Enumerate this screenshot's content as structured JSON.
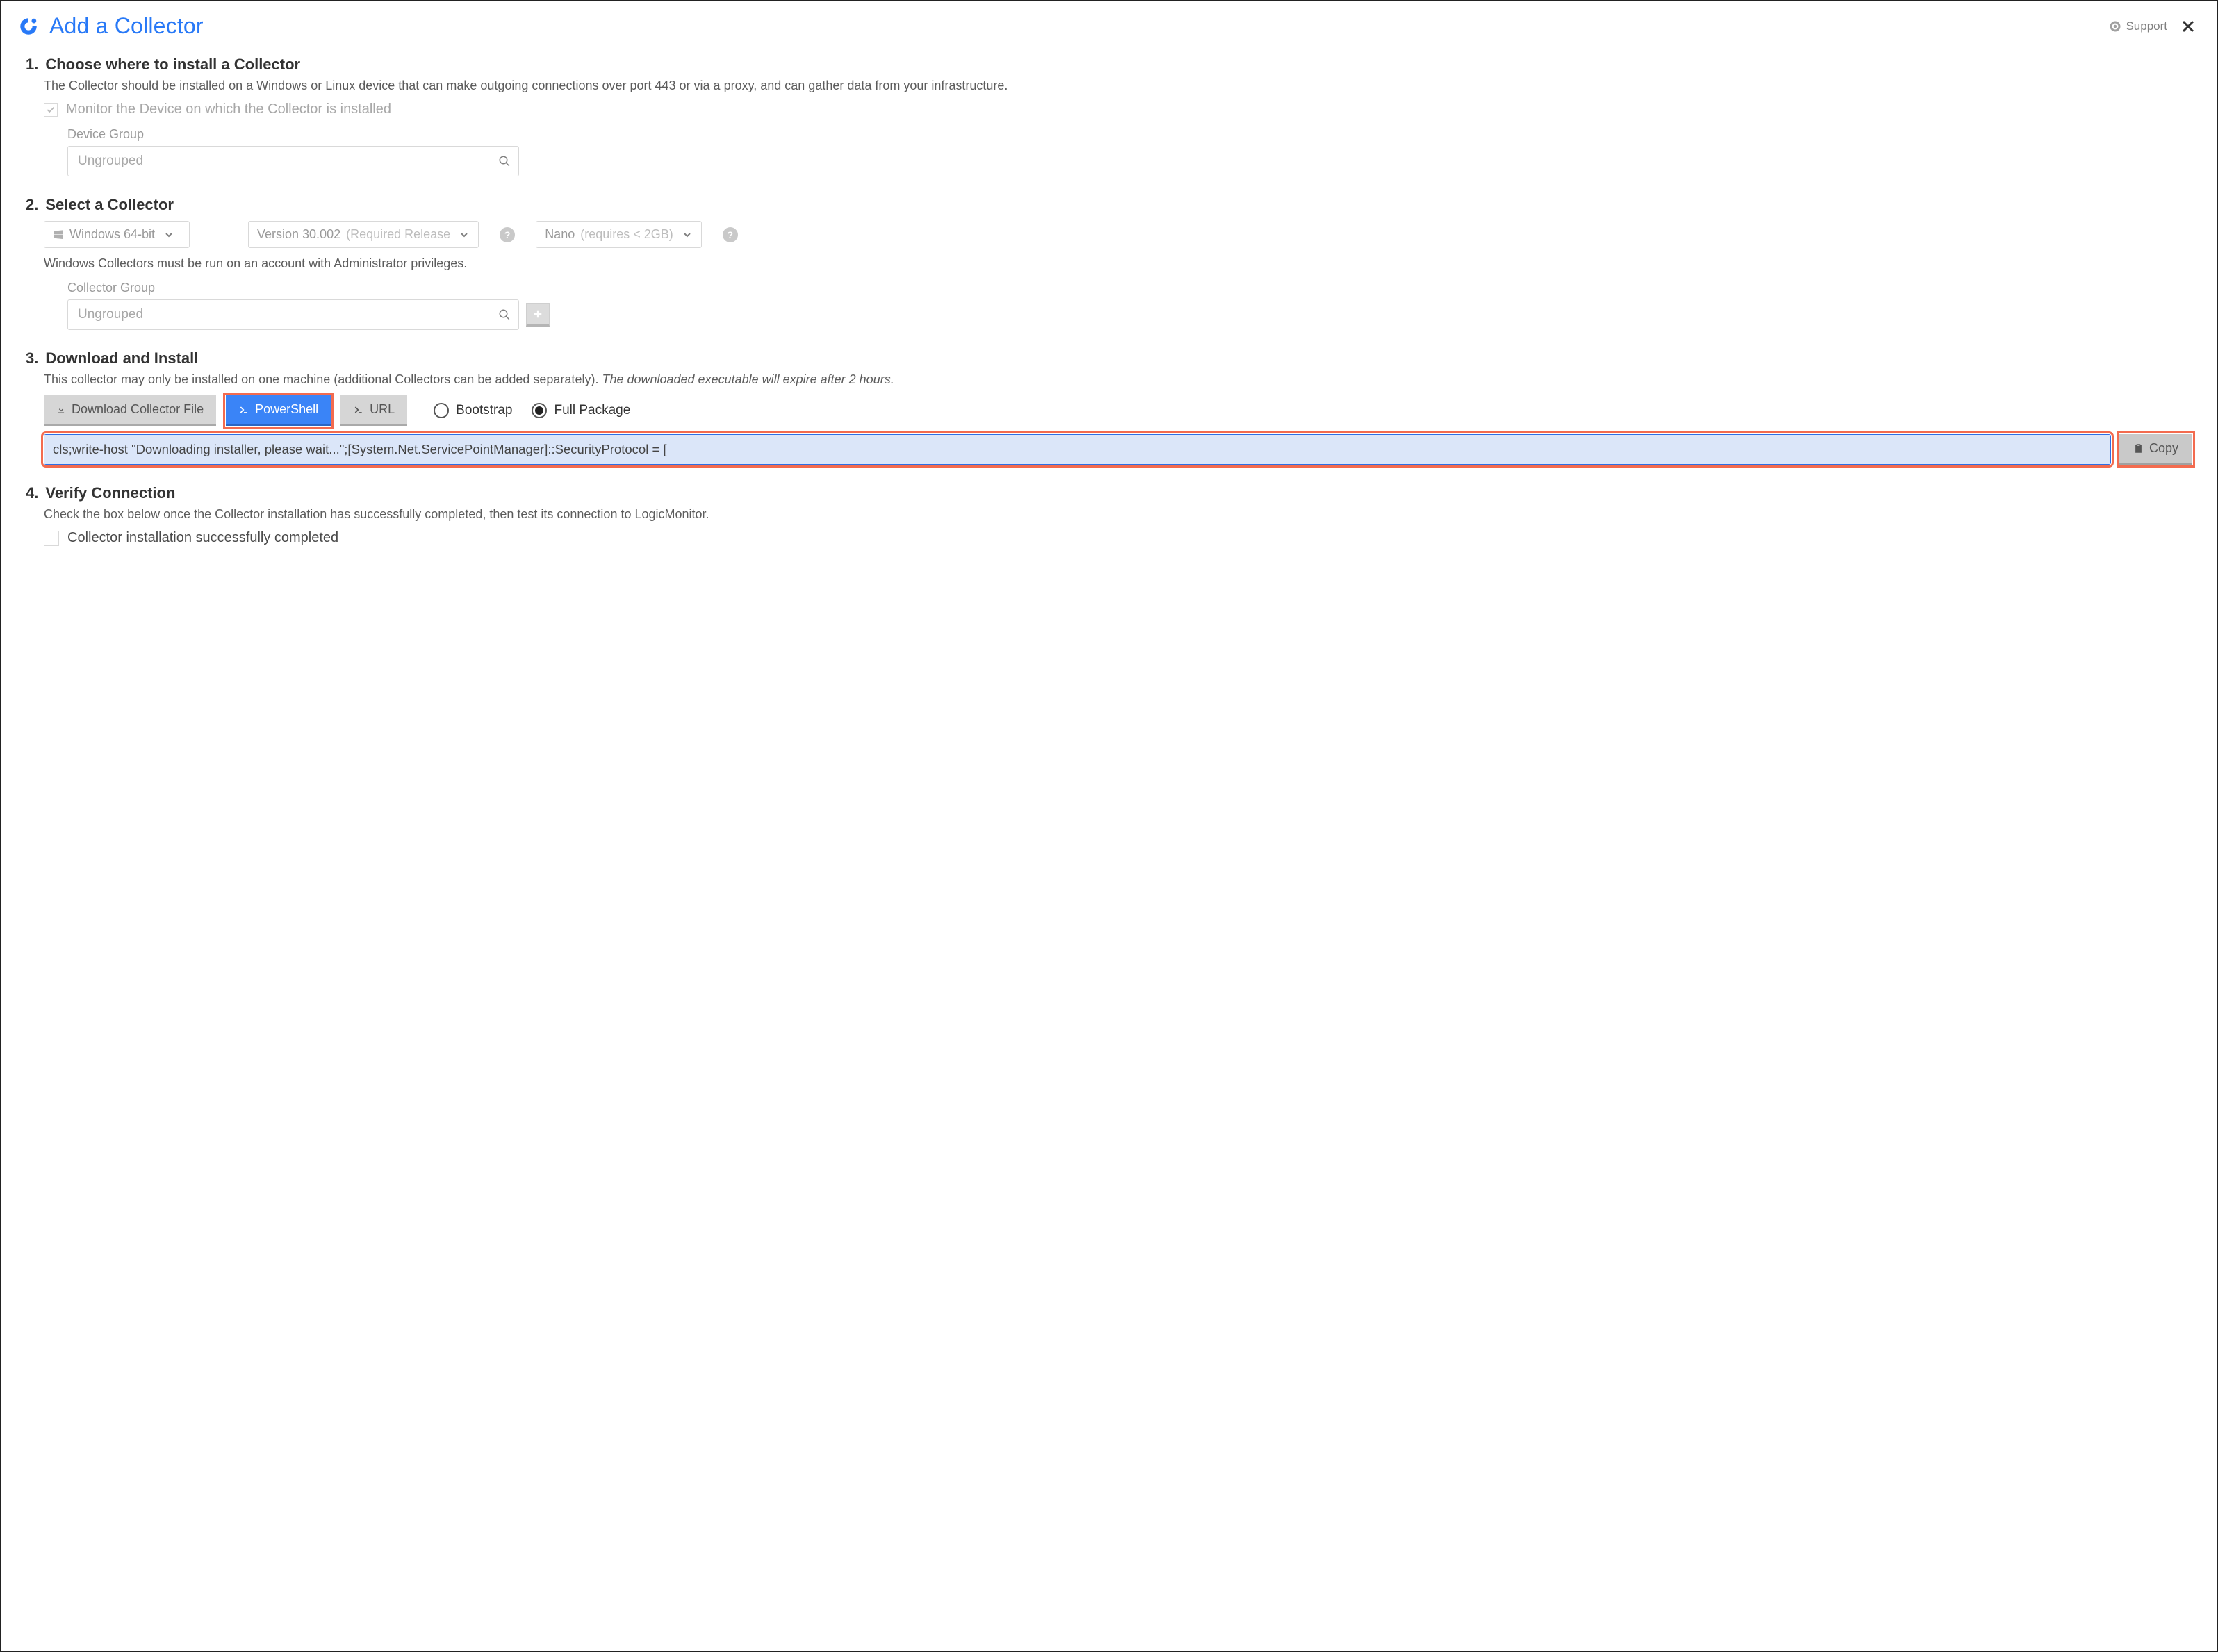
{
  "header": {
    "title": "Add a Collector",
    "support_label": "Support"
  },
  "step1": {
    "num": "1.",
    "title": "Choose where to install a Collector",
    "desc": "The Collector should be installed on a Windows or Linux device that can make outgoing connections over port 443 or via a proxy, and can gather data from your infrastructure.",
    "monitor_label": "Monitor the Device on which the Collector is installed",
    "monitor_checked": true,
    "device_group_label": "Device Group",
    "device_group_value": "Ungrouped"
  },
  "step2": {
    "num": "2.",
    "title": "Select a Collector",
    "os": {
      "label": "Windows 64-bit"
    },
    "version": {
      "label": "Version 30.002",
      "paren": "(Required Release"
    },
    "size": {
      "label": "Nano",
      "paren": "(requires < 2GB)"
    },
    "note": "Windows Collectors must be run on an account with Administrator privileges.",
    "collector_group_label": "Collector Group",
    "collector_group_value": "Ungrouped"
  },
  "step3": {
    "num": "3.",
    "title": "Download and Install",
    "desc_plain": "This collector may only be installed on one machine (additional Collectors can be added separately). ",
    "desc_italic": "The downloaded executable will expire after 2 hours.",
    "btn_download": "Download Collector File",
    "btn_powershell": "PowerShell",
    "btn_url": "URL",
    "radio_bootstrap": "Bootstrap",
    "radio_full": "Full Package",
    "radio_selected": "full",
    "command": "cls;write-host \"Downloading installer, please wait...\";[System.Net.ServicePointManager]::SecurityProtocol = [",
    "copy_label": "Copy"
  },
  "step4": {
    "num": "4.",
    "title": "Verify Connection",
    "desc": "Check the box below once the Collector installation has successfully completed, then test its connection to LogicMonitor.",
    "confirm_label": "Collector installation successfully completed",
    "confirm_checked": false
  }
}
